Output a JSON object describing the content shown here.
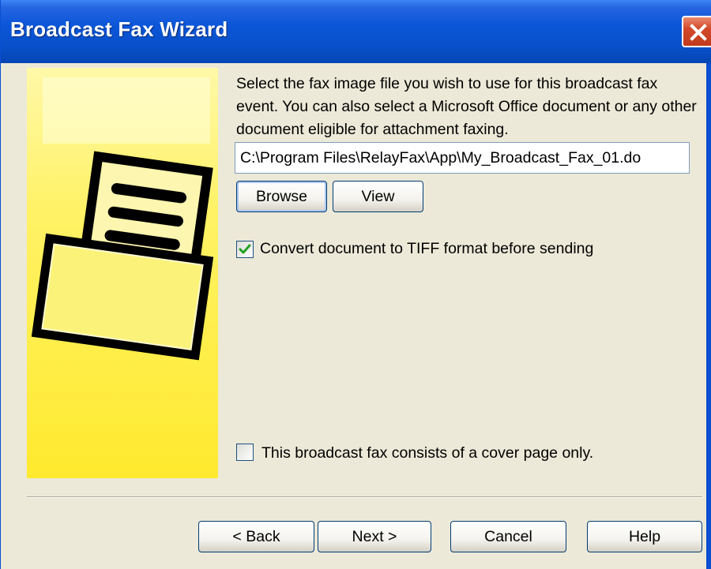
{
  "window": {
    "title": "Broadcast Fax Wizard"
  },
  "main": {
    "description": "Select the fax image file you wish to use for this broadcast fax event.  You can also select a Microsoft Office document or any other document eligible for attachment faxing.",
    "file_path": "C:\\Program Files\\RelayFax\\App\\My_Broadcast_Fax_01.do",
    "browse_label": "Browse",
    "view_label": "View",
    "convert_tiff": {
      "label": "Convert document to TIFF format before sending",
      "checked": true
    },
    "cover_only": {
      "label": "This broadcast fax consists of a cover page only.",
      "checked": false
    }
  },
  "footer": {
    "back_label": "< Back",
    "next_label": "Next >",
    "cancel_label": "Cancel",
    "help_label": "Help"
  },
  "colors": {
    "titlebar": "#0850c8",
    "panel_yellow": "#ffea2e",
    "check_green": "#21a121"
  },
  "icons": {
    "close": "close-icon",
    "fax_document": "fax-document-icon",
    "checkmark": "checkmark-icon"
  }
}
